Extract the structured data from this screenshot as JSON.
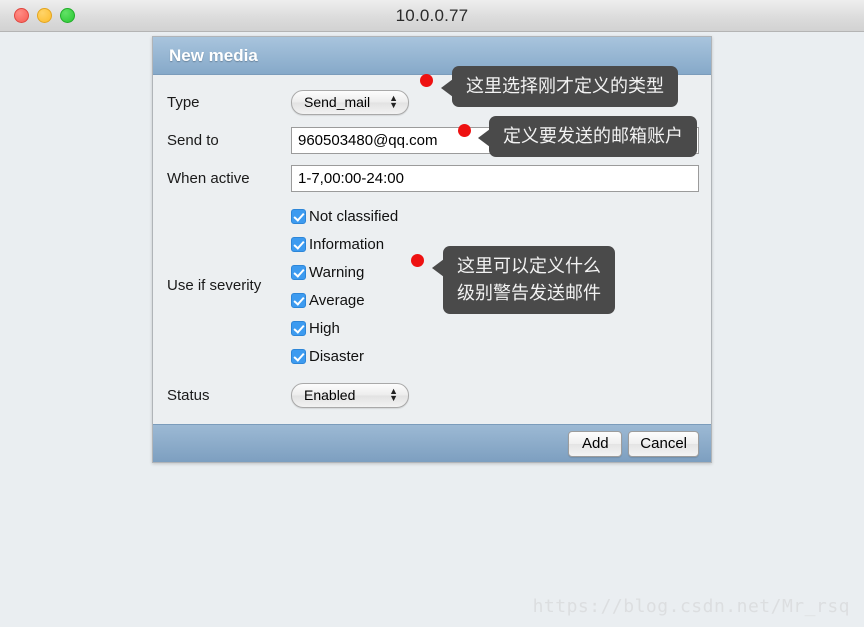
{
  "window": {
    "title": "10.0.0.77",
    "controls": [
      {
        "name": "close",
        "color": "#f75c54"
      },
      {
        "name": "minimize",
        "color": "#fcbc2c"
      },
      {
        "name": "zoom",
        "color": "#29c732"
      }
    ]
  },
  "dialog": {
    "title": "New media",
    "fields": {
      "type": {
        "label": "Type",
        "value": "Send_mail"
      },
      "send_to": {
        "label": "Send to",
        "value": "960503480@qq.com"
      },
      "when_active": {
        "label": "When active",
        "value": "1-7,00:00-24:00"
      },
      "severity": {
        "label": "Use if severity",
        "items": [
          {
            "label": "Not classified",
            "checked": true
          },
          {
            "label": "Information",
            "checked": true
          },
          {
            "label": "Warning",
            "checked": true
          },
          {
            "label": "Average",
            "checked": true
          },
          {
            "label": "High",
            "checked": true
          },
          {
            "label": "Disaster",
            "checked": true
          }
        ]
      },
      "status": {
        "label": "Status",
        "value": "Enabled"
      }
    },
    "footer": {
      "add_label": "Add",
      "cancel_label": "Cancel"
    }
  },
  "annotations": [
    {
      "id": "type",
      "text": "这里选择刚才定义的类型"
    },
    {
      "id": "sendto",
      "text": "定义要发送的邮箱账户"
    },
    {
      "id": "severity",
      "text": "这里可以定义什么\n级别警告发送邮件"
    }
  ],
  "watermark": "https://blog.csdn.net/Mr_rsq",
  "colors": {
    "marker": "#ee1111",
    "callout_bg": "#4a4a4a",
    "header_blue": "#86a9c9",
    "checkbox_blue": "#3d9bf0"
  }
}
